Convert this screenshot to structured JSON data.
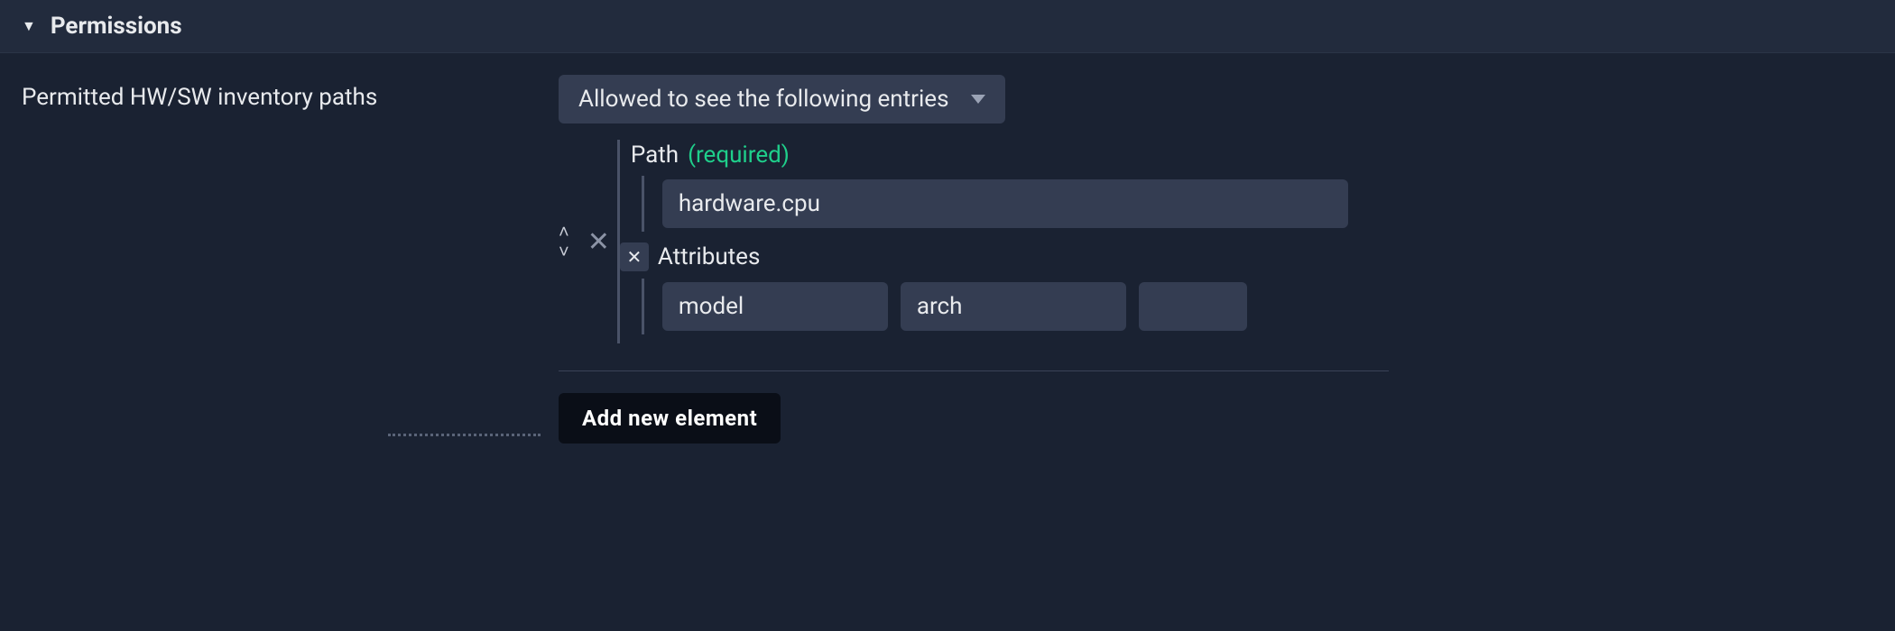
{
  "section": {
    "title": "Permissions"
  },
  "field": {
    "label": "Permitted HW/SW inventory paths",
    "mode_selected": "Allowed to see the following entries"
  },
  "entry": {
    "path_label": "Path",
    "path_required": "(required)",
    "path_value": "hardware.cpu",
    "attributes_label": "Attributes",
    "attributes": {
      "v0": "model",
      "v1": "arch",
      "v2": ""
    }
  },
  "buttons": {
    "add_element": "Add new element"
  }
}
